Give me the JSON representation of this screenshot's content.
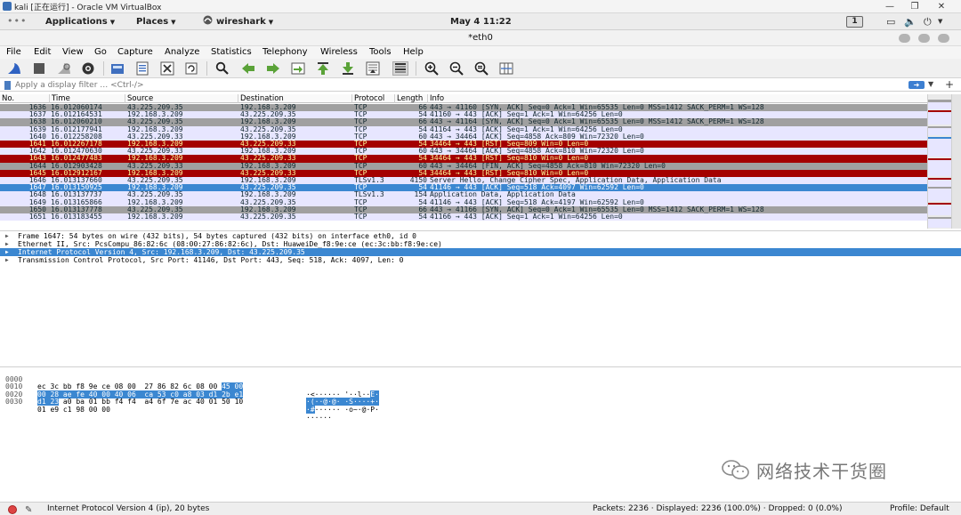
{
  "vbox": {
    "title": "kali [正在运行] - Oracle VM VirtualBox"
  },
  "gnome": {
    "dots": "•••",
    "applications": "Applications",
    "places": "Places",
    "app": "wireshark",
    "clock": "May 4  11:22",
    "workspace": "1"
  },
  "window": {
    "title": "*eth0"
  },
  "menu": {
    "file": "File",
    "edit": "Edit",
    "view": "View",
    "go": "Go",
    "capture": "Capture",
    "analyze": "Analyze",
    "statistics": "Statistics",
    "telephony": "Telephony",
    "wireless": "Wireless",
    "tools": "Tools",
    "help": "Help"
  },
  "filter": {
    "placeholder": "Apply a display filter … <Ctrl-/>"
  },
  "columns": {
    "no": "No.",
    "time": "Time",
    "source": "Source",
    "destination": "Destination",
    "protocol": "Protocol",
    "length": "Length",
    "info": "Info"
  },
  "colors": {
    "tcp_rst": "#a40000",
    "tcp_syn": "#a0a0a0",
    "tcp_normal": "#e7e6ff",
    "tls": "#e7e6ff",
    "selected": "#3b87d1"
  },
  "packets": [
    {
      "no": "1636",
      "time": "16.012060174",
      "src": "43.225.209.35",
      "dst": "192.168.3.209",
      "proto": "TCP",
      "len": "66",
      "info": "443 → 41160 [SYN, ACK] Seq=0 Ack=1 Win=65535 Len=0 MSS=1412 SACK_PERM=1 WS=128",
      "kind": "syn"
    },
    {
      "no": "1637",
      "time": "16.012164531",
      "src": "192.168.3.209",
      "dst": "43.225.209.35",
      "proto": "TCP",
      "len": "54",
      "info": "41160 → 443 [ACK] Seq=1 Ack=1 Win=64256 Len=0",
      "kind": "normal"
    },
    {
      "no": "1638",
      "time": "16.012060210",
      "src": "43.225.209.35",
      "dst": "192.168.3.209",
      "proto": "TCP",
      "len": "66",
      "info": "443 → 41164 [SYN, ACK] Seq=0 Ack=1 Win=65535 Len=0 MSS=1412 SACK_PERM=1 WS=128",
      "kind": "syn"
    },
    {
      "no": "1639",
      "time": "16.012177941",
      "src": "192.168.3.209",
      "dst": "43.225.209.35",
      "proto": "TCP",
      "len": "54",
      "info": "41164 → 443 [ACK] Seq=1 Ack=1 Win=64256 Len=0",
      "kind": "normal"
    },
    {
      "no": "1640",
      "time": "16.012258208",
      "src": "43.225.209.33",
      "dst": "192.168.3.209",
      "proto": "TCP",
      "len": "60",
      "info": "443 → 34464 [ACK] Seq=4858 Ack=809 Win=72320 Len=0",
      "kind": "normal"
    },
    {
      "no": "1641",
      "time": "16.012267178",
      "src": "192.168.3.209",
      "dst": "43.225.209.33",
      "proto": "TCP",
      "len": "54",
      "info": "34464 → 443 [RST] Seq=809 Win=0 Len=0",
      "kind": "rst"
    },
    {
      "no": "1642",
      "time": "16.012470630",
      "src": "43.225.209.33",
      "dst": "192.168.3.209",
      "proto": "TCP",
      "len": "60",
      "info": "443 → 34464 [ACK] Seq=4858 Ack=810 Win=72320 Len=0",
      "kind": "normal"
    },
    {
      "no": "1643",
      "time": "16.012477483",
      "src": "192.168.3.209",
      "dst": "43.225.209.33",
      "proto": "TCP",
      "len": "54",
      "info": "34464 → 443 [RST] Seq=810 Win=0 Len=0",
      "kind": "rst"
    },
    {
      "no": "1644",
      "time": "16.012903428",
      "src": "43.225.209.33",
      "dst": "192.168.3.209",
      "proto": "TCP",
      "len": "60",
      "info": "443 → 34464 [FIN, ACK] Seq=4858 Ack=810 Win=72320 Len=0",
      "kind": "syn"
    },
    {
      "no": "1645",
      "time": "16.012912167",
      "src": "192.168.3.209",
      "dst": "43.225.209.33",
      "proto": "TCP",
      "len": "54",
      "info": "34464 → 443 [RST] Seq=810 Win=0 Len=0",
      "kind": "rst"
    },
    {
      "no": "1646",
      "time": "16.013137660",
      "src": "43.225.209.35",
      "dst": "192.168.3.209",
      "proto": "TLSv1.3",
      "len": "4150",
      "info": "Server Hello, Change Cipher Spec, Application Data, Application Data",
      "kind": "normal"
    },
    {
      "no": "1647",
      "time": "16.013150925",
      "src": "192.168.3.209",
      "dst": "43.225.209.35",
      "proto": "TCP",
      "len": "54",
      "info": "41146 → 443 [ACK] Seq=518 Ack=4097 Win=62592 Len=0",
      "kind": "selected"
    },
    {
      "no": "1648",
      "time": "16.013137737",
      "src": "43.225.209.35",
      "dst": "192.168.3.209",
      "proto": "TLSv1.3",
      "len": "154",
      "info": "Application Data, Application Data",
      "kind": "normal"
    },
    {
      "no": "1649",
      "time": "16.013165866",
      "src": "192.168.3.209",
      "dst": "43.225.209.35",
      "proto": "TCP",
      "len": "54",
      "info": "41146 → 443 [ACK] Seq=518 Ack=4197 Win=62592 Len=0",
      "kind": "normal"
    },
    {
      "no": "1650",
      "time": "16.013137778",
      "src": "43.225.209.35",
      "dst": "192.168.3.209",
      "proto": "TCP",
      "len": "66",
      "info": "443 → 41166 [SYN, ACK] Seq=0 Ack=1 Win=65535 Len=0 MSS=1412 SACK_PERM=1 WS=128",
      "kind": "syn"
    },
    {
      "no": "1651",
      "time": "16.013183455",
      "src": "192.168.3.209",
      "dst": "43.225.209.35",
      "proto": "TCP",
      "len": "54",
      "info": "41166 → 443 [ACK] Seq=1 Ack=1 Win=64256 Len=0",
      "kind": "normal"
    }
  ],
  "details": [
    "Frame 1647: 54 bytes on wire (432 bits), 54 bytes captured (432 bits) on interface eth0, id 0",
    "Ethernet II, Src: PcsCompu_86:82:6c (08:00:27:86:82:6c), Dst: HuaweiDe_f8:9e:ce (ec:3c:bb:f8:9e:ce)",
    "Internet Protocol Version 4, Src: 192.168.3.209, Dst: 43.225.209.35",
    "Transmission Control Protocol, Src Port: 41146, Dst Port: 443, Seq: 518, Ack: 4097, Len: 0"
  ],
  "bytes": [
    {
      "off": "0000",
      "hex_pre": "ec 3c bb f8 9e ce 08 00  27 86 82 6c 08 00 ",
      "hex_hl": "45 00",
      "ascii_pre": "·<······ '··l··",
      "ascii_hl": "E·"
    },
    {
      "off": "0010",
      "hex_pre": "",
      "hex_hl": "00 28 ae fe 40 00 40 06  ca 53 c0 a8 03 d1 2b e1",
      "ascii_pre": "",
      "ascii_hl": "·(··@·@· ·S····+·"
    },
    {
      "off": "0020",
      "hex_pre": "",
      "hex_hl": "d1 23",
      "hex_post": " a0 ba 01 bb f4 f4  a4 6f 7e ac 40 01 50 10",
      "ascii_pre": "",
      "ascii_hl": "·#",
      "ascii_post": "······ ·o~·@·P·"
    },
    {
      "off": "0030",
      "hex_pre": "01 e9 c1 98 00 00",
      "hex_hl": "",
      "ascii_pre": "······",
      "ascii_hl": ""
    }
  ],
  "watermark": "网络技术干货圈",
  "status": {
    "field": "Internet Protocol Version 4 (ip), 20 bytes",
    "packets": "Packets: 2236 · Displayed: 2236 (100.0%) · Dropped: 0 (0.0%)",
    "profile": "Profile: Default"
  }
}
